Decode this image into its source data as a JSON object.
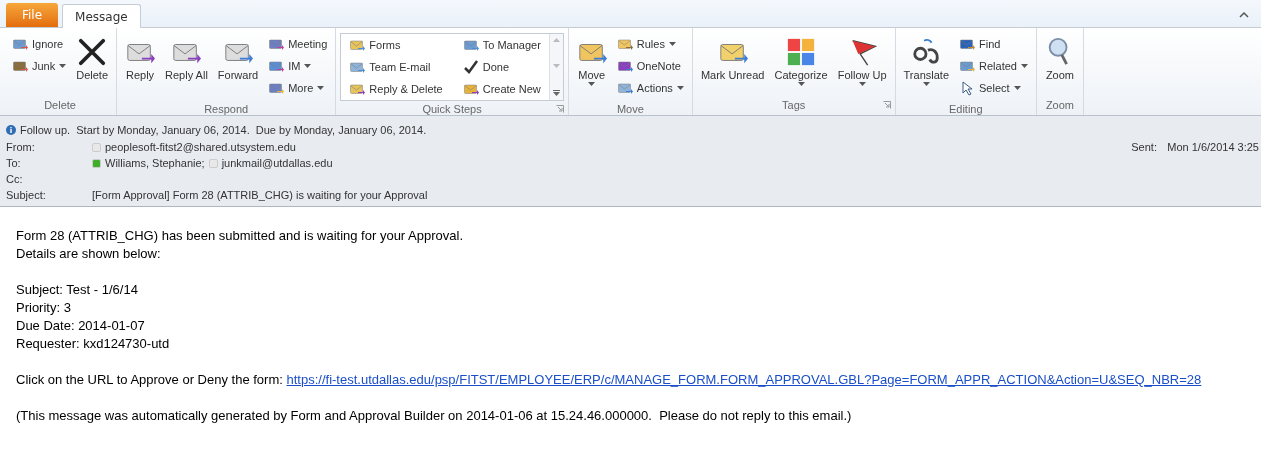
{
  "tabs": [
    {
      "label": "File",
      "kind": "file",
      "selected": false
    },
    {
      "label": "Message",
      "kind": "tab",
      "selected": true
    }
  ],
  "ribbon": [
    {
      "label": "Delete",
      "launcher": false,
      "items": [
        {
          "kind": "small",
          "label": "Ignore",
          "dropdown": false
        },
        {
          "kind": "small",
          "label": "Junk",
          "dropdown": true
        },
        {
          "kind": "large",
          "label": "Delete",
          "dropdown": false
        }
      ]
    },
    {
      "label": "Respond",
      "launcher": false,
      "items": [
        {
          "kind": "large",
          "label": "Reply",
          "dropdown": false
        },
        {
          "kind": "large",
          "label": "Reply All",
          "dropdown": false
        },
        {
          "kind": "large",
          "label": "Forward",
          "dropdown": false
        },
        {
          "kind": "small",
          "label": "Meeting",
          "dropdown": false
        },
        {
          "kind": "small",
          "label": "IM",
          "dropdown": true
        },
        {
          "kind": "small",
          "label": "More",
          "dropdown": true
        }
      ]
    },
    {
      "label": "Quick Steps",
      "launcher": true,
      "items": [
        {
          "kind": "gallery",
          "label": "Forms",
          "dropdown": false
        },
        {
          "kind": "gallery",
          "label": "Team E-mail",
          "dropdown": false
        },
        {
          "kind": "gallery",
          "label": "Reply & Delete",
          "dropdown": false
        },
        {
          "kind": "gallery",
          "label": "To Manager",
          "dropdown": false
        },
        {
          "kind": "gallery",
          "label": "Done",
          "dropdown": false
        },
        {
          "kind": "gallery",
          "label": "Create New",
          "dropdown": false
        }
      ]
    },
    {
      "label": "Move",
      "launcher": false,
      "items": [
        {
          "kind": "large",
          "label": "Move",
          "dropdown": true
        },
        {
          "kind": "small",
          "label": "Rules",
          "dropdown": true
        },
        {
          "kind": "small",
          "label": "OneNote",
          "dropdown": false
        },
        {
          "kind": "small",
          "label": "Actions",
          "dropdown": true
        }
      ]
    },
    {
      "label": "Tags",
      "launcher": true,
      "items": [
        {
          "kind": "large",
          "label": "Mark Unread",
          "dropdown": false
        },
        {
          "kind": "large",
          "label": "Categorize",
          "dropdown": true
        },
        {
          "kind": "large",
          "label": "Follow Up",
          "dropdown": true
        }
      ]
    },
    {
      "label": "Editing",
      "launcher": false,
      "items": [
        {
          "kind": "large",
          "label": "Translate",
          "dropdown": true
        },
        {
          "kind": "small",
          "label": "Find",
          "dropdown": false
        },
        {
          "kind": "small",
          "label": "Related",
          "dropdown": true
        },
        {
          "kind": "small",
          "label": "Select",
          "dropdown": true
        }
      ]
    },
    {
      "label": "Zoom",
      "launcher": false,
      "items": [
        {
          "kind": "large",
          "label": "Zoom",
          "dropdown": false
        }
      ]
    }
  ],
  "infobar": "Follow up.  Start by Monday, January 06, 2014.  Due by Monday, January 06, 2014.",
  "header": {
    "from_label": "From:",
    "from": [
      {
        "name": "peoplesoft-fitst2@shared.utsystem.edu",
        "color": "#e8e8e8"
      }
    ],
    "to_label": "To:",
    "to": [
      {
        "name": "Williams, Stephanie;",
        "color": "#3fae2a"
      },
      {
        "name": "junkmail@utdallas.edu",
        "color": "#e8e8e8"
      }
    ],
    "cc_label": "Cc:",
    "subject_label": "Subject:",
    "subject": "[Form Approval] Form 28 (ATTRIB_CHG) is waiting for your Approval",
    "sent_label": "Sent:",
    "sent": "Mon 1/6/2014 3:25"
  },
  "body": {
    "paragraphs": [
      [
        "Form 28 (ATTRIB_CHG) has been submitted and is waiting for your Approval.",
        "Details are shown below:"
      ],
      [
        "Subject: Test - 1/6/14",
        "Priority: 3",
        "Due Date: 2014-01-07",
        "Requester: kxd124730-utd"
      ]
    ],
    "link_sentence": "Click on the URL to Approve or Deny the form:",
    "link": "https://fi-test.utdallas.edu/psp/FITST/EMPLOYEE/ERP/c/MANAGE_FORM.FORM_APPROVAL.GBL?Page=FORM_APPR_ACTION&Action=U&SEQ_NBR=28",
    "footer": "(This message was automatically generated by Form and Approval Builder on 2014-01-06 at 15.24.46.000000.  Please do not reply to this email.)"
  }
}
